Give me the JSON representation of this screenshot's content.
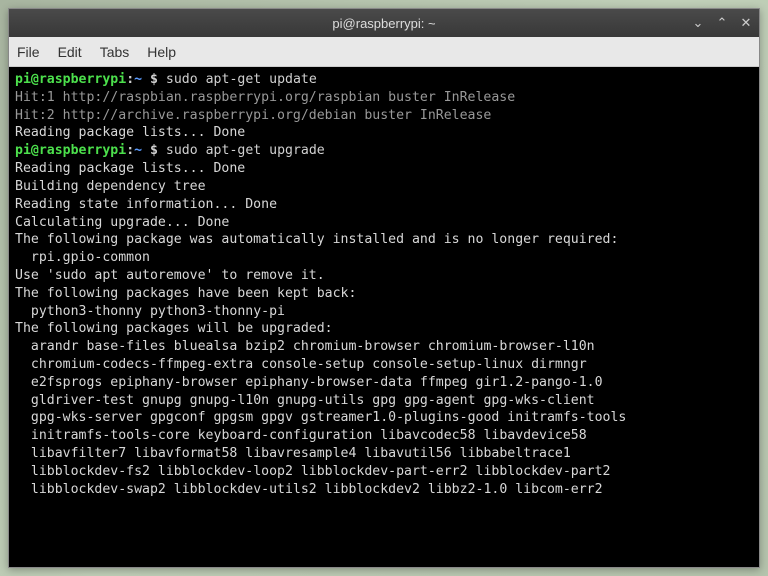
{
  "window": {
    "title": "pi@raspberrypi: ~"
  },
  "menubar": {
    "file": "File",
    "edit": "Edit",
    "tabs": "Tabs",
    "help": "Help"
  },
  "controls": {
    "min": "⌄",
    "max": "⌃",
    "close": "✕"
  },
  "terminal": {
    "prompt": {
      "user": "pi",
      "at": "@",
      "host": "raspberrypi",
      "colon": ":",
      "path": "~",
      "dollar": " $ "
    },
    "cmd1": "sudo apt-get update",
    "line_hit1": "Hit:1 http://raspbian.raspberrypi.org/raspbian buster InRelease",
    "line_hit2": "Hit:2 http://archive.raspberrypi.org/debian buster InRelease",
    "line_reading1": "Reading package lists... Done",
    "cmd2": "sudo apt-get upgrade",
    "line_reading2": "Reading package lists... Done",
    "line_building": "Building dependency tree",
    "line_state": "Reading state information... Done",
    "line_calc": "Calculating upgrade... Done",
    "line_auto": "The following package was automatically installed and is no longer required:",
    "line_rpi": "  rpi.gpio-common",
    "line_autoremove": "Use 'sudo apt autoremove' to remove it.",
    "line_kept": "The following packages have been kept back:",
    "line_kept_pkgs": "  python3-thonny python3-thonny-pi",
    "line_upgraded": "The following packages will be upgraded:",
    "line_pkg1": "  arandr base-files bluealsa bzip2 chromium-browser chromium-browser-l10n",
    "line_pkg2": "  chromium-codecs-ffmpeg-extra console-setup console-setup-linux dirmngr",
    "line_pkg3": "  e2fsprogs epiphany-browser epiphany-browser-data ffmpeg gir1.2-pango-1.0",
    "line_pkg4": "  gldriver-test gnupg gnupg-l10n gnupg-utils gpg gpg-agent gpg-wks-client",
    "line_pkg5": "  gpg-wks-server gpgconf gpgsm gpgv gstreamer1.0-plugins-good initramfs-tools",
    "line_pkg6": "  initramfs-tools-core keyboard-configuration libavcodec58 libavdevice58",
    "line_pkg7": "  libavfilter7 libavformat58 libavresample4 libavutil56 libbabeltrace1",
    "line_pkg8": "  libblockdev-fs2 libblockdev-loop2 libblockdev-part-err2 libblockdev-part2",
    "line_pkg9": "  libblockdev-swap2 libblockdev-utils2 libblockdev2 libbz2-1.0 libcom-err2"
  }
}
